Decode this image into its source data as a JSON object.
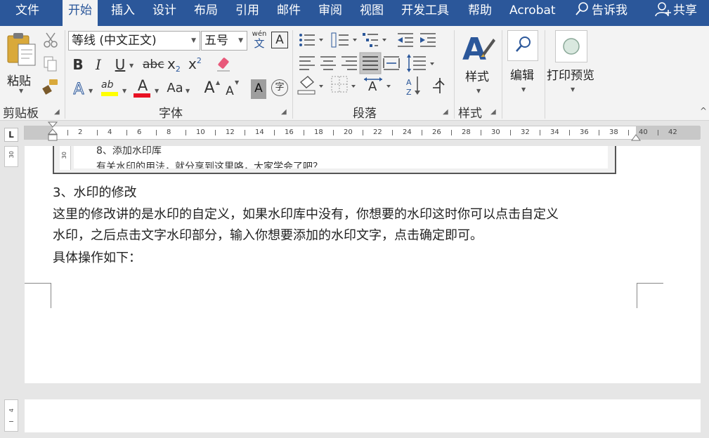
{
  "menu": {
    "tabs": [
      "文件",
      "开始",
      "插入",
      "设计",
      "布局",
      "引用",
      "邮件",
      "审阅",
      "视图",
      "开发工具",
      "帮助",
      "Acrobat"
    ],
    "active": "开始",
    "tell_me": "告诉我",
    "share": "共享"
  },
  "ribbon": {
    "clipboard": {
      "paste_label": "粘贴",
      "group_label": "剪贴板"
    },
    "font": {
      "font_name": "等线 (中文正文)",
      "font_size": "五号",
      "phonetic_top": "wén",
      "phonetic_bottom": "文",
      "border_char": "A",
      "bold": "B",
      "italic": "I",
      "underline": "U",
      "strike": "abc",
      "subscript": "x",
      "subscript_small": "2",
      "superscript": "x",
      "superscript_small": "2",
      "text_effect": "A",
      "highlight": "ab",
      "font_color": "A",
      "change_case": "Aa",
      "grow": "A",
      "shrink": "A",
      "char_shading": "A",
      "enclose": "字",
      "group_label": "字体"
    },
    "paragraph": {
      "group_label": "段落"
    },
    "styles": {
      "label": "样式",
      "group_label": "样式"
    },
    "editing": {
      "label": "编辑"
    },
    "print": {
      "label": "打印预览"
    }
  },
  "ruler": {
    "corner": "L",
    "ticks": [
      "2",
      "4",
      "6",
      "8",
      "10",
      "12",
      "14",
      "16",
      "18",
      "20",
      "22",
      "24",
      "26",
      "28",
      "30",
      "32",
      "34",
      "36",
      "38",
      "40",
      "42"
    ]
  },
  "vruler": {
    "label_top": "30",
    "label_bottom": "4"
  },
  "document": {
    "embedded_line1": "8、添加水印库",
    "embedded_line2": "有关水印的用法，就分享到这里咯，大家学会了吧？",
    "heading": "3、水印的修改",
    "para_line1": "这里的修改讲的是水印的自定义，如果水印库中没有，你想要的水印这时你可以点击自定义",
    "para_line2": "水印，之后点击文字水印部分，输入你想要添加的水印文字，点击确定即可。",
    "para_line3": "具体操作如下："
  },
  "colors": {
    "brand": "#2b579a",
    "highlight": "#ffff00",
    "font_color": "#e81123"
  }
}
